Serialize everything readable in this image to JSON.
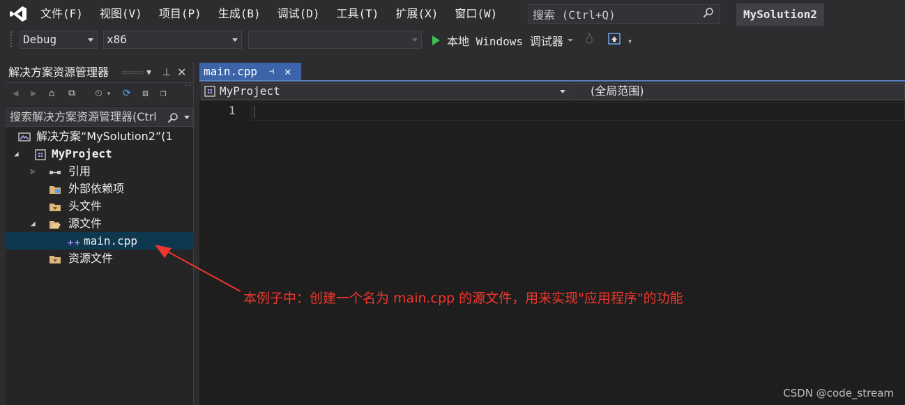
{
  "menubar": {
    "items": [
      "文件(F)",
      "视图(V)",
      "项目(P)",
      "生成(B)",
      "调试(D)",
      "工具(T)",
      "扩展(X)",
      "窗口(W)"
    ],
    "search_placeholder": "搜索 (Ctrl+Q)",
    "solution_name": "MySolution2"
  },
  "toolbar": {
    "configuration": "Debug",
    "platform": "x86",
    "startup_item": "",
    "run_label": "本地 Windows 调试器"
  },
  "solution_explorer": {
    "title": "解决方案资源管理器",
    "search_placeholder": "搜索解决方案资源管理器(Ctrl",
    "tree": [
      {
        "label": "解决方案“MySolution2”(1",
        "level": 0,
        "icon": "solution-icon"
      },
      {
        "label": "MyProject",
        "level": 1,
        "icon": "project-icon",
        "bold": true
      },
      {
        "label": "引用",
        "level": 2,
        "icon": "references-icon"
      },
      {
        "label": "外部依赖项",
        "level": 2,
        "icon": "external-deps-icon"
      },
      {
        "label": "头文件",
        "level": 2,
        "icon": "folder-icon"
      },
      {
        "label": "源文件",
        "level": 2,
        "icon": "folder-open-icon"
      },
      {
        "label": "main.cpp",
        "level": 3,
        "icon": "cpp-file-icon",
        "selected": true
      },
      {
        "label": "资源文件",
        "level": 2,
        "icon": "folder-icon"
      }
    ]
  },
  "editor": {
    "tab_label": "main.cpp",
    "nav_project": "MyProject",
    "nav_scope": "(全局范围)",
    "line_number": "1"
  },
  "annotation": "本例子中：创建一个名为 main.cpp 的源文件，用来实现\"应用程序\"的功能",
  "watermark": "CSDN @code_stream",
  "colors": {
    "accent_tab": "#3c64a8",
    "selection": "#0e3750",
    "annotation": "#f0372e",
    "play": "#3ec14e",
    "vs_logo": "#b497ff"
  }
}
